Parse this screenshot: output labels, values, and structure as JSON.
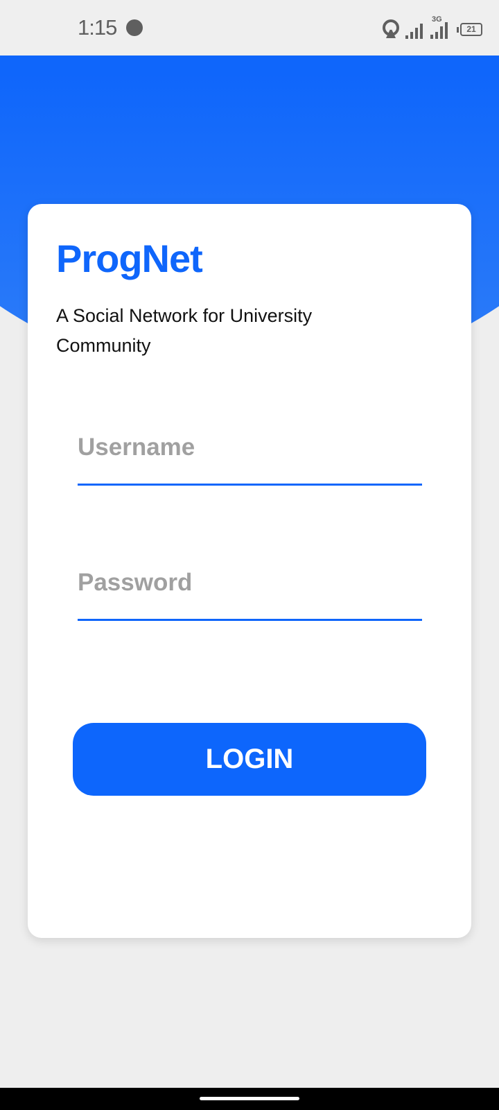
{
  "status_bar": {
    "time": "1:15",
    "network_type": "3G",
    "battery": "21",
    "icons": [
      "recording-dot-icon",
      "hotspot-icon",
      "signal-icon",
      "signal-3g-icon",
      "battery-icon"
    ]
  },
  "app": {
    "title": "ProgNet",
    "subtitle": "A Social Network for University Community"
  },
  "form": {
    "username_placeholder": "Username",
    "password_placeholder": "Password",
    "login_label": "LOGIN"
  },
  "colors": {
    "accent": "#0f66fb",
    "background": "#eeeeee",
    "placeholder": "#a0a0a0"
  }
}
